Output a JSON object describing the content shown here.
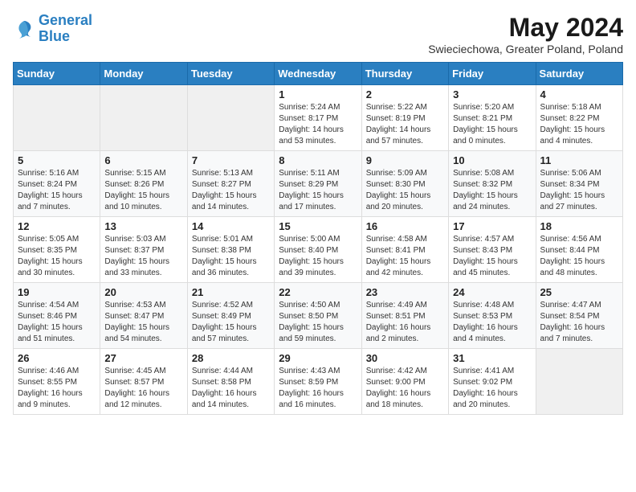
{
  "header": {
    "logo_line1": "General",
    "logo_line2": "Blue",
    "month_title": "May 2024",
    "location": "Swieciechowa, Greater Poland, Poland"
  },
  "columns": [
    "Sunday",
    "Monday",
    "Tuesday",
    "Wednesday",
    "Thursday",
    "Friday",
    "Saturday"
  ],
  "weeks": [
    [
      {
        "day": "",
        "text": ""
      },
      {
        "day": "",
        "text": ""
      },
      {
        "day": "",
        "text": ""
      },
      {
        "day": "1",
        "text": "Sunrise: 5:24 AM\nSunset: 8:17 PM\nDaylight: 14 hours\nand 53 minutes."
      },
      {
        "day": "2",
        "text": "Sunrise: 5:22 AM\nSunset: 8:19 PM\nDaylight: 14 hours\nand 57 minutes."
      },
      {
        "day": "3",
        "text": "Sunrise: 5:20 AM\nSunset: 8:21 PM\nDaylight: 15 hours\nand 0 minutes."
      },
      {
        "day": "4",
        "text": "Sunrise: 5:18 AM\nSunset: 8:22 PM\nDaylight: 15 hours\nand 4 minutes."
      }
    ],
    [
      {
        "day": "5",
        "text": "Sunrise: 5:16 AM\nSunset: 8:24 PM\nDaylight: 15 hours\nand 7 minutes."
      },
      {
        "day": "6",
        "text": "Sunrise: 5:15 AM\nSunset: 8:26 PM\nDaylight: 15 hours\nand 10 minutes."
      },
      {
        "day": "7",
        "text": "Sunrise: 5:13 AM\nSunset: 8:27 PM\nDaylight: 15 hours\nand 14 minutes."
      },
      {
        "day": "8",
        "text": "Sunrise: 5:11 AM\nSunset: 8:29 PM\nDaylight: 15 hours\nand 17 minutes."
      },
      {
        "day": "9",
        "text": "Sunrise: 5:09 AM\nSunset: 8:30 PM\nDaylight: 15 hours\nand 20 minutes."
      },
      {
        "day": "10",
        "text": "Sunrise: 5:08 AM\nSunset: 8:32 PM\nDaylight: 15 hours\nand 24 minutes."
      },
      {
        "day": "11",
        "text": "Sunrise: 5:06 AM\nSunset: 8:34 PM\nDaylight: 15 hours\nand 27 minutes."
      }
    ],
    [
      {
        "day": "12",
        "text": "Sunrise: 5:05 AM\nSunset: 8:35 PM\nDaylight: 15 hours\nand 30 minutes."
      },
      {
        "day": "13",
        "text": "Sunrise: 5:03 AM\nSunset: 8:37 PM\nDaylight: 15 hours\nand 33 minutes."
      },
      {
        "day": "14",
        "text": "Sunrise: 5:01 AM\nSunset: 8:38 PM\nDaylight: 15 hours\nand 36 minutes."
      },
      {
        "day": "15",
        "text": "Sunrise: 5:00 AM\nSunset: 8:40 PM\nDaylight: 15 hours\nand 39 minutes."
      },
      {
        "day": "16",
        "text": "Sunrise: 4:58 AM\nSunset: 8:41 PM\nDaylight: 15 hours\nand 42 minutes."
      },
      {
        "day": "17",
        "text": "Sunrise: 4:57 AM\nSunset: 8:43 PM\nDaylight: 15 hours\nand 45 minutes."
      },
      {
        "day": "18",
        "text": "Sunrise: 4:56 AM\nSunset: 8:44 PM\nDaylight: 15 hours\nand 48 minutes."
      }
    ],
    [
      {
        "day": "19",
        "text": "Sunrise: 4:54 AM\nSunset: 8:46 PM\nDaylight: 15 hours\nand 51 minutes."
      },
      {
        "day": "20",
        "text": "Sunrise: 4:53 AM\nSunset: 8:47 PM\nDaylight: 15 hours\nand 54 minutes."
      },
      {
        "day": "21",
        "text": "Sunrise: 4:52 AM\nSunset: 8:49 PM\nDaylight: 15 hours\nand 57 minutes."
      },
      {
        "day": "22",
        "text": "Sunrise: 4:50 AM\nSunset: 8:50 PM\nDaylight: 15 hours\nand 59 minutes."
      },
      {
        "day": "23",
        "text": "Sunrise: 4:49 AM\nSunset: 8:51 PM\nDaylight: 16 hours\nand 2 minutes."
      },
      {
        "day": "24",
        "text": "Sunrise: 4:48 AM\nSunset: 8:53 PM\nDaylight: 16 hours\nand 4 minutes."
      },
      {
        "day": "25",
        "text": "Sunrise: 4:47 AM\nSunset: 8:54 PM\nDaylight: 16 hours\nand 7 minutes."
      }
    ],
    [
      {
        "day": "26",
        "text": "Sunrise: 4:46 AM\nSunset: 8:55 PM\nDaylight: 16 hours\nand 9 minutes."
      },
      {
        "day": "27",
        "text": "Sunrise: 4:45 AM\nSunset: 8:57 PM\nDaylight: 16 hours\nand 12 minutes."
      },
      {
        "day": "28",
        "text": "Sunrise: 4:44 AM\nSunset: 8:58 PM\nDaylight: 16 hours\nand 14 minutes."
      },
      {
        "day": "29",
        "text": "Sunrise: 4:43 AM\nSunset: 8:59 PM\nDaylight: 16 hours\nand 16 minutes."
      },
      {
        "day": "30",
        "text": "Sunrise: 4:42 AM\nSunset: 9:00 PM\nDaylight: 16 hours\nand 18 minutes."
      },
      {
        "day": "31",
        "text": "Sunrise: 4:41 AM\nSunset: 9:02 PM\nDaylight: 16 hours\nand 20 minutes."
      },
      {
        "day": "",
        "text": ""
      }
    ]
  ]
}
